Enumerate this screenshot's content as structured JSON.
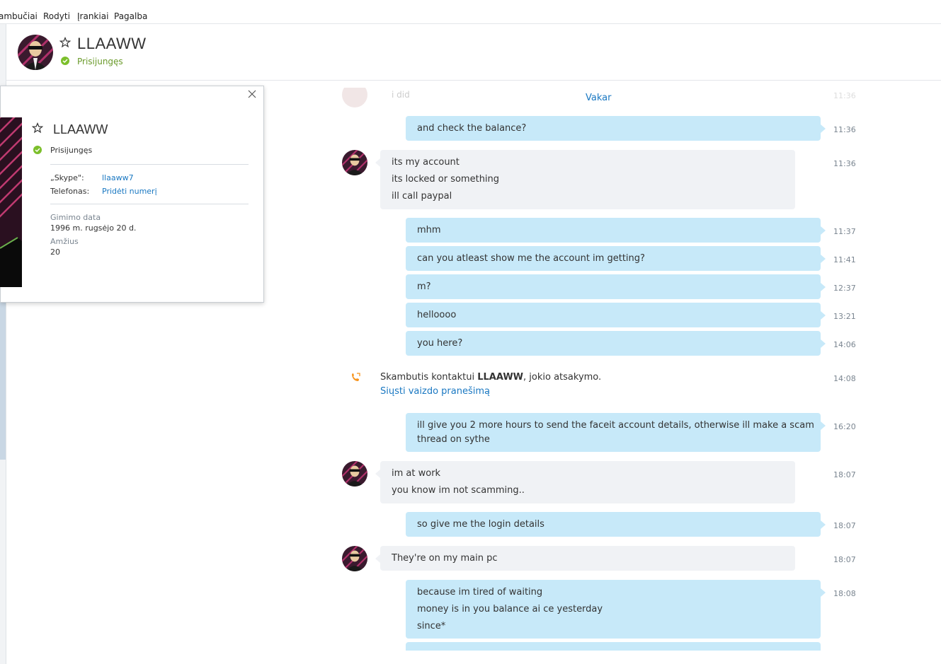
{
  "menu": [
    "ambučiai",
    "Rodyti",
    "Įrankiai",
    "Pagalba"
  ],
  "contact": {
    "name": "LLAAWW",
    "status": "Prisijungęs"
  },
  "chat": {
    "faded_text": "i did",
    "faded_time": "11:36",
    "day_separator": "Vakar",
    "call": {
      "prefix": "Skambutis kontaktui ",
      "name": "LLAAWW",
      "suffix": ", jokio atsakymo.",
      "link": "Siųsti vaizdo pranešimą",
      "time": "14:08"
    },
    "messages": [
      {
        "dir": "out",
        "lines": [
          "and check the balance?"
        ],
        "time": "11:36"
      },
      {
        "dir": "in",
        "lines": [
          "its my account",
          "its locked or something",
          "ill call paypal"
        ],
        "time": "11:36"
      },
      {
        "dir": "out",
        "lines": [
          "mhm"
        ],
        "time": "11:37"
      },
      {
        "dir": "out",
        "lines": [
          "can you atleast show me the account im getting?"
        ],
        "time": "11:41"
      },
      {
        "dir": "out",
        "lines": [
          "m?"
        ],
        "time": "12:37"
      },
      {
        "dir": "out",
        "lines": [
          "helloooo"
        ],
        "time": "13:21"
      },
      {
        "dir": "out",
        "lines": [
          "you here?"
        ],
        "time": "14:06"
      },
      {
        "dir": "out",
        "lines": [
          "ill give you 2 more hours to send the faceit account details, otherwise ill make a scam",
          "thread on sythe"
        ],
        "time": "16:20"
      },
      {
        "dir": "in",
        "lines": [
          "im at work",
          "you know im not scamming.."
        ],
        "time": "18:07"
      },
      {
        "dir": "out",
        "lines": [
          "so give me the login details"
        ],
        "time": "18:07"
      },
      {
        "dir": "in",
        "lines": [
          "They're on my main pc"
        ],
        "time": "18:07"
      },
      {
        "dir": "out",
        "lines": [
          "because im tired of waiting",
          "money is in you balance ai ce yesterday",
          "since*"
        ],
        "time": "18:08"
      }
    ]
  },
  "profile": {
    "name": "LLAAWW",
    "status": "Prisijungęs",
    "skype_label": "„Skype\":",
    "skype_value": "llaaww7",
    "phone_label": "Telefonas:",
    "phone_value": "Pridėti numerį",
    "birth_label": "Gimimo data",
    "birth_value": "1996 m. rugsėjo 20 d.",
    "age_label": "Amžius",
    "age_value": "20"
  },
  "colors": {
    "accent": "#1a78c2",
    "outgoing": "#c7e9f9",
    "incoming": "#f0f2f5",
    "online": "#7cbf2b",
    "call": "#f7941d"
  },
  "icons": [
    "star-icon",
    "online-status-icon",
    "close-icon",
    "call-icon",
    "avatar"
  ]
}
